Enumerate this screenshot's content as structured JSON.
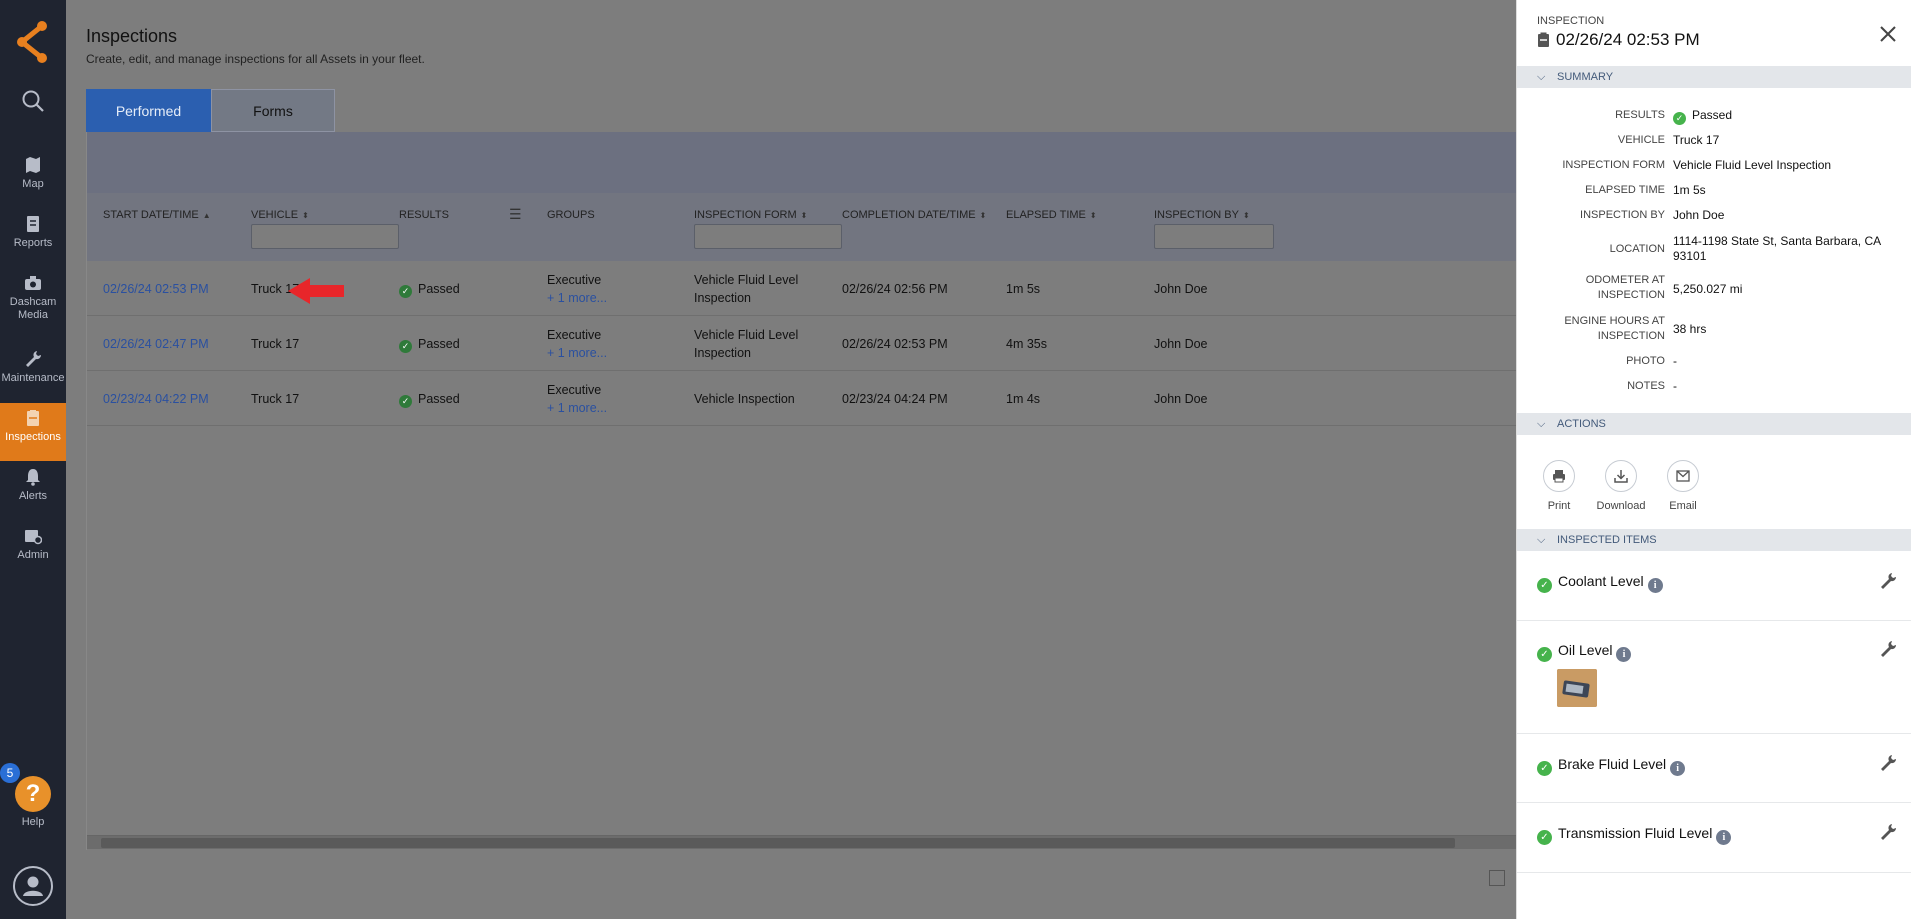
{
  "sidebar": {
    "items": [
      {
        "label": "Map",
        "icon": "map-icon"
      },
      {
        "label": "Reports",
        "icon": "reports-icon"
      },
      {
        "label": "Dashcam Media",
        "icon": "camera-icon"
      },
      {
        "label": "Maintenance",
        "icon": "wrench-icon"
      },
      {
        "label": "Inspections",
        "icon": "inspections-icon",
        "active": true
      },
      {
        "label": "Alerts",
        "icon": "bell-icon"
      },
      {
        "label": "Admin",
        "icon": "admin-icon"
      }
    ],
    "help_label": "Help",
    "help_badge": "5",
    "accent": "#e07a1a"
  },
  "page": {
    "title": "Inspections",
    "subtitle": "Create, edit, and manage inspections for all Assets in your fleet."
  },
  "tabs": [
    {
      "label": "Performed",
      "active": true
    },
    {
      "label": "Forms",
      "active": false
    }
  ],
  "table": {
    "columns": [
      "START DATE/TIME",
      "VEHICLE",
      "RESULTS",
      "GROUPS",
      "INSPECTION FORM",
      "COMPLETION DATE/TIME",
      "ELAPSED TIME",
      "INSPECTION BY"
    ],
    "rows": [
      {
        "start": "02/26/24 02:53 PM",
        "vehicle": "Truck 17",
        "result": "Passed",
        "group": "Executive",
        "more": "+ 1 more...",
        "form": [
          "Vehicle Fluid Level",
          "Inspection"
        ],
        "completion": "02/26/24 02:56 PM",
        "elapsed": "1m 5s",
        "by": "John Doe"
      },
      {
        "start": "02/26/24 02:47 PM",
        "vehicle": "Truck 17",
        "result": "Passed",
        "group": "Executive",
        "more": "+ 1 more...",
        "form": [
          "Vehicle Fluid Level",
          "Inspection"
        ],
        "completion": "02/26/24 02:53 PM",
        "elapsed": "4m 35s",
        "by": "John Doe"
      },
      {
        "start": "02/23/24 04:22 PM",
        "vehicle": "Truck 17",
        "result": "Passed",
        "group": "Executive",
        "more": "+ 1 more...",
        "form": [
          "Vehicle Inspection",
          ""
        ],
        "completion": "02/23/24 04:24 PM",
        "elapsed": "1m 4s",
        "by": "John Doe"
      }
    ]
  },
  "panel": {
    "kicker": "INSPECTION",
    "title": "02/26/24 02:53 PM",
    "sections": {
      "summary": "SUMMARY",
      "actions": "ACTIONS",
      "items": "INSPECTED ITEMS"
    },
    "summary": [
      {
        "label": "RESULTS",
        "value": "Passed"
      },
      {
        "label": "VEHICLE",
        "value": "Truck 17"
      },
      {
        "label": "INSPECTION FORM",
        "value": "Vehicle Fluid Level Inspection"
      },
      {
        "label": "ELAPSED TIME",
        "value": "1m 5s"
      },
      {
        "label": "INSPECTION BY",
        "value": "John Doe"
      },
      {
        "label": "LOCATION",
        "value": "1114-1198 State St, Santa Barbara, CA",
        "value2": "93101"
      },
      {
        "label": "ODOMETER AT",
        "label2": "INSPECTION",
        "value": "5,250.027 mi"
      },
      {
        "label": "ENGINE HOURS AT",
        "label2": "INSPECTION",
        "value": "38 hrs"
      },
      {
        "label": "PHOTO",
        "value": "-"
      },
      {
        "label": "NOTES",
        "value": "-"
      }
    ],
    "actions": [
      "Print",
      "Download",
      "Email"
    ],
    "inspected_items": [
      "Coolant Level",
      "Oil Level",
      "Brake Fluid Level",
      "Transmission Fluid Level"
    ]
  }
}
